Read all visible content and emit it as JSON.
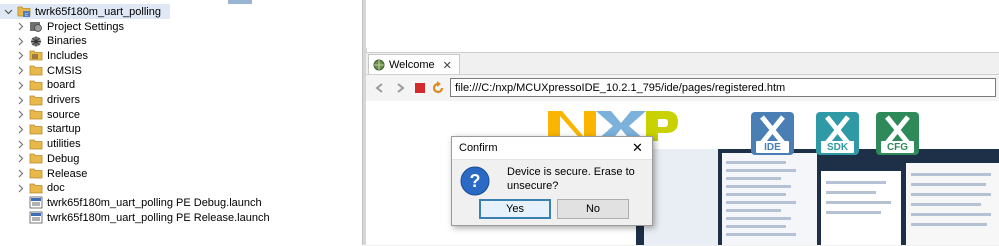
{
  "explorer": {
    "root": {
      "label": "twrk65f180m_uart_polling"
    },
    "items": [
      {
        "label": "Project Settings",
        "icon": "settings-icon",
        "expandable": true
      },
      {
        "label": "Binaries",
        "icon": "binaries-icon",
        "expandable": true
      },
      {
        "label": "Includes",
        "icon": "includes-icon",
        "expandable": true
      },
      {
        "label": "CMSIS",
        "icon": "folder-icon",
        "expandable": true
      },
      {
        "label": "board",
        "icon": "folder-icon",
        "expandable": true
      },
      {
        "label": "drivers",
        "icon": "folder-icon",
        "expandable": true
      },
      {
        "label": "source",
        "icon": "folder-icon",
        "expandable": true
      },
      {
        "label": "startup",
        "icon": "folder-icon",
        "expandable": true
      },
      {
        "label": "utilities",
        "icon": "folder-icon",
        "expandable": true
      },
      {
        "label": "Debug",
        "icon": "folder-icon",
        "expandable": true
      },
      {
        "label": "Release",
        "icon": "folder-icon",
        "expandable": true
      },
      {
        "label": "doc",
        "icon": "folder-icon",
        "expandable": true
      },
      {
        "label": "twrk65f180m_uart_polling PE Debug.launch",
        "icon": "launch-file-icon",
        "expandable": false
      },
      {
        "label": "twrk65f180m_uart_polling PE Release.launch",
        "icon": "launch-file-icon",
        "expandable": false
      }
    ]
  },
  "welcome": {
    "tab_label": "Welcome",
    "url": "file:///C:/nxp/MCUXpressoIDE_10.2.1_795/ide/pages/registered.htm",
    "badges": [
      {
        "label": "IDE",
        "color": "#4a7fb5"
      },
      {
        "label": "SDK",
        "color": "#2f9aa6"
      },
      {
        "label": "CFG",
        "color": "#2f8a5a"
      }
    ]
  },
  "dialog": {
    "title": "Confirm",
    "message": "Device is secure. Erase to unsecure?",
    "yes_label": "Yes",
    "no_label": "No"
  },
  "colors": {
    "nxp_n": "#f9b500",
    "nxp_x": "#7bb1db",
    "nxp_p": "#c9d200",
    "folder": "#e8b84a"
  }
}
